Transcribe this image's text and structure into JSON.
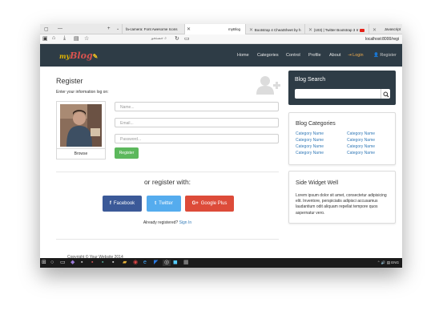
{
  "browser": {
    "tabs": [
      {
        "label": "fa-camera: Font Awesome Icons"
      },
      {
        "label": "myBlog"
      },
      {
        "label": "Bootstrap 4 CheatSheet by h"
      },
      {
        "label": "(103) | Twitter Bootstrap 3 Ir"
      },
      {
        "label": "Javascript"
      }
    ],
    "address_text": "جستجو",
    "url": "localhost:8000/regi"
  },
  "site": {
    "logo_prefix": "my",
    "logo_main": "Blog",
    "nav": [
      "Home",
      "Categories",
      "Control",
      "Profile",
      "About"
    ],
    "login": "Login",
    "register": "Register"
  },
  "form": {
    "title": "Register",
    "subtitle": "Enter your information log on:",
    "browse": "Browse",
    "name_placeholder": "Name...",
    "email_placeholder": "Email...",
    "password_placeholder": "Password...",
    "submit": "Register",
    "or_register": "or register with:",
    "social": [
      {
        "label": "Facebook",
        "icon": "f"
      },
      {
        "label": "Twitter",
        "icon": "t"
      },
      {
        "label": "Google Plus",
        "icon": "G+"
      }
    ],
    "already": "Already registered?",
    "signin": "Sign In"
  },
  "sidebar": {
    "search_title": "Blog Search",
    "categories_title": "Blog Categories",
    "categories": [
      "Category Name",
      "Category Name",
      "Category Name",
      "Category Name",
      "Category Name",
      "Category Name",
      "Category Name",
      "Category Name"
    ],
    "widget_title": "Side Widget Well",
    "widget_text": "Lorem ipsum dolor sit amet, consectetur adipisicing elit. Inventore, perspiciatis adipisci accusamus laudantium odit aliquam repellat tempore quos aspernatur vero."
  },
  "footer": {
    "copyright": "Copyright © Your Website 2014"
  },
  "taskbar": {
    "lang": "ENG"
  },
  "colors": {
    "header": "#2e3c46",
    "register_button": "#5cb85c",
    "facebook": "#3b5998",
    "twitter": "#55acee",
    "google": "#dd4b39",
    "link": "#337ab7",
    "login": "#f0ad4e"
  }
}
